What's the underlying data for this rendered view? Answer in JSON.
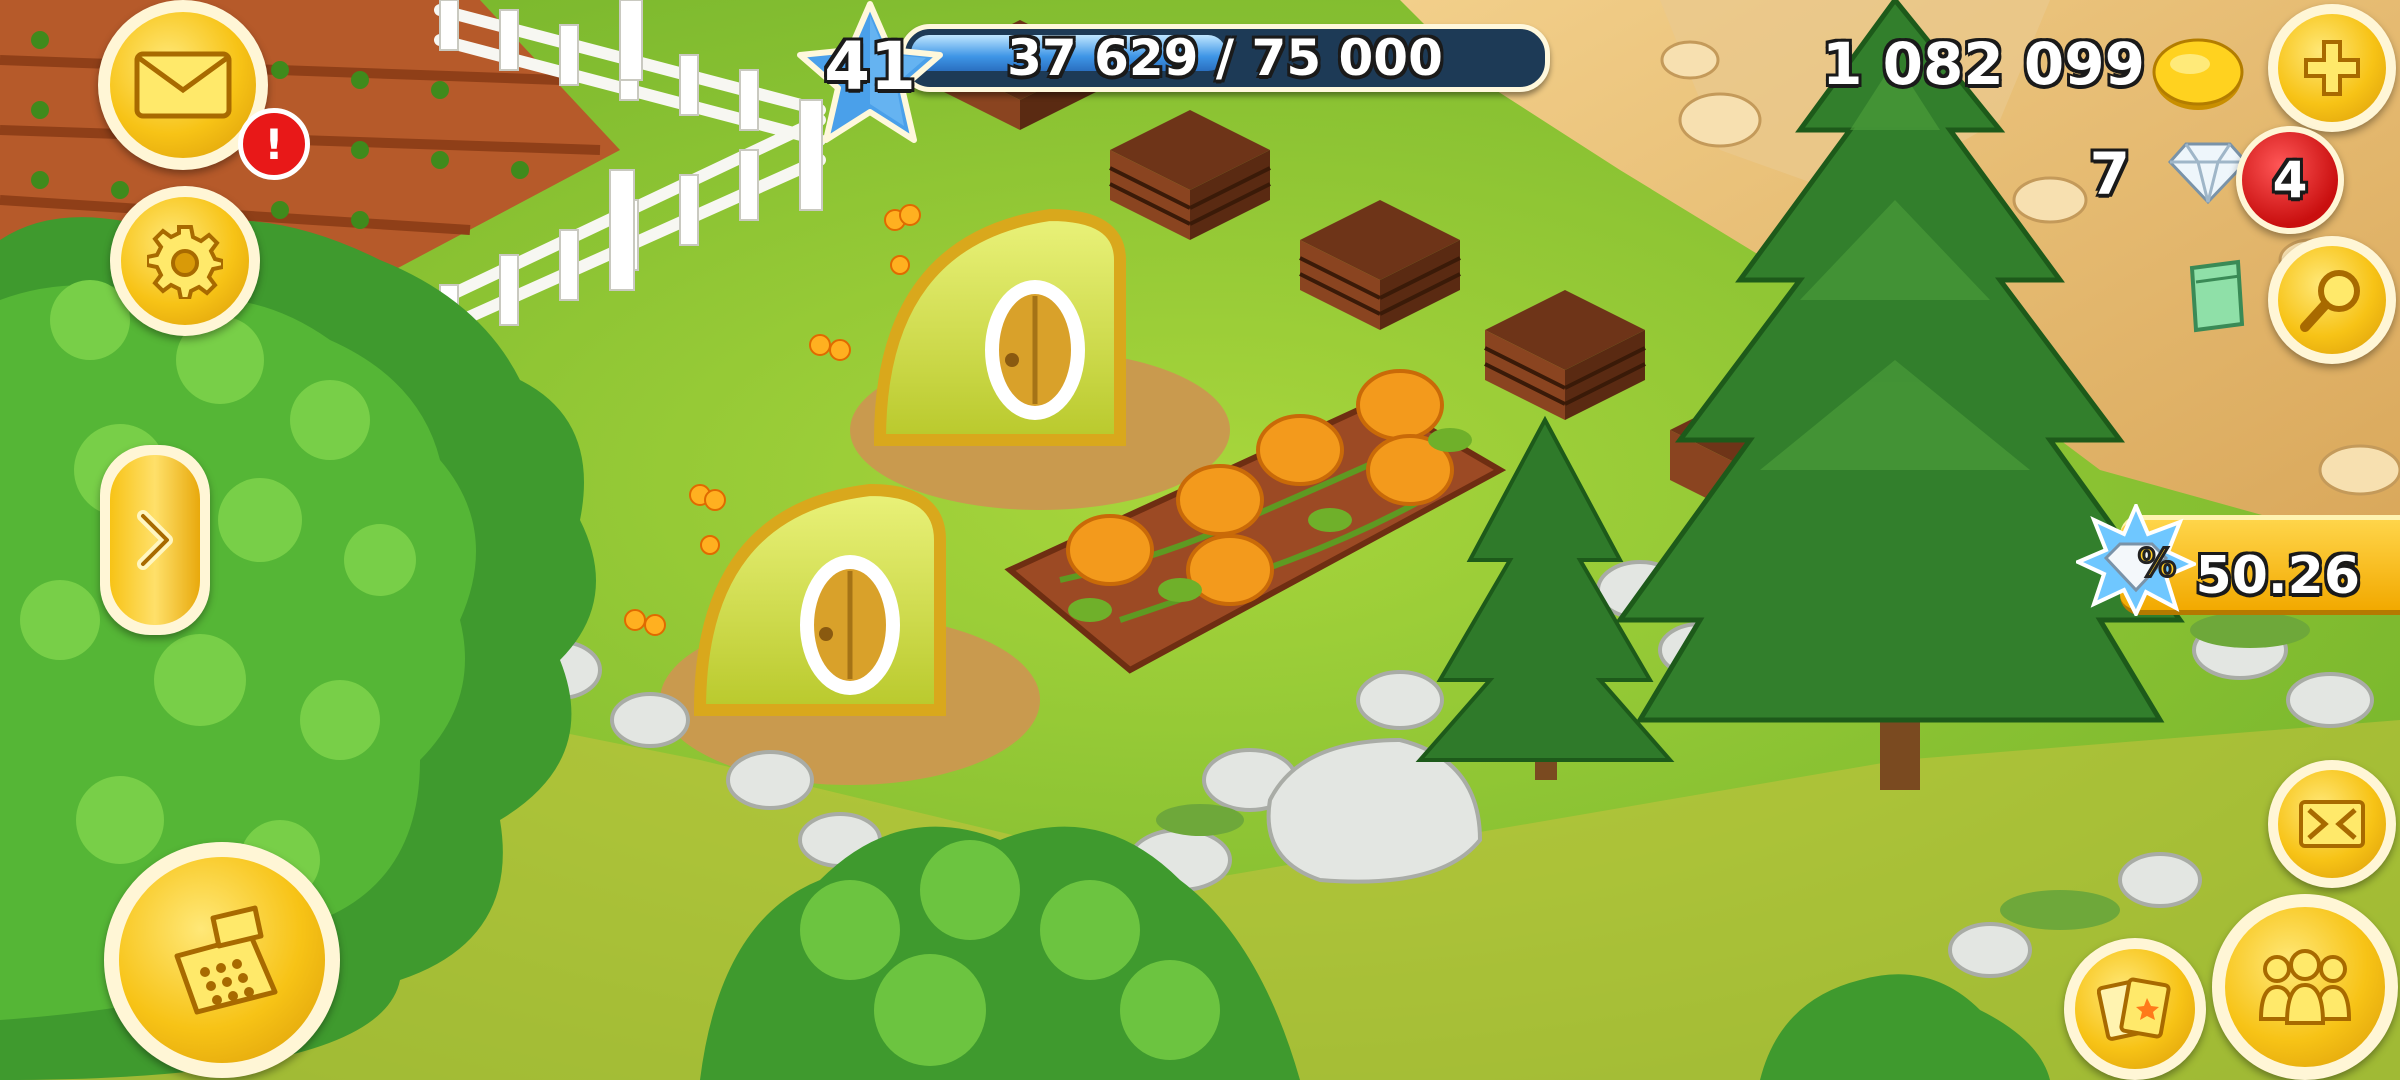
{
  "hud": {
    "level": "41",
    "xp_text": "37 629 / 75 000",
    "xp_progress": 0.502,
    "coins": "1 082 099",
    "diamonds": "7",
    "notification_count": "4",
    "mail_alert": "!",
    "offer_timer": "50.26"
  },
  "icons": {
    "mail": "mail-icon",
    "settings": "gear-icon",
    "expand": "chevron-right-icon",
    "shop": "cash-register-icon",
    "add_currency": "plus-icon",
    "search": "magnifier-icon",
    "map": "map-icon",
    "friends": "friends-icon",
    "cards": "cards-icon",
    "offer": "diamond-percent-icon"
  },
  "colors": {
    "gold": "#f7c316",
    "xp_blue": "#3e95e6",
    "alert_red": "#e81818",
    "grass": "#8cc63a"
  }
}
